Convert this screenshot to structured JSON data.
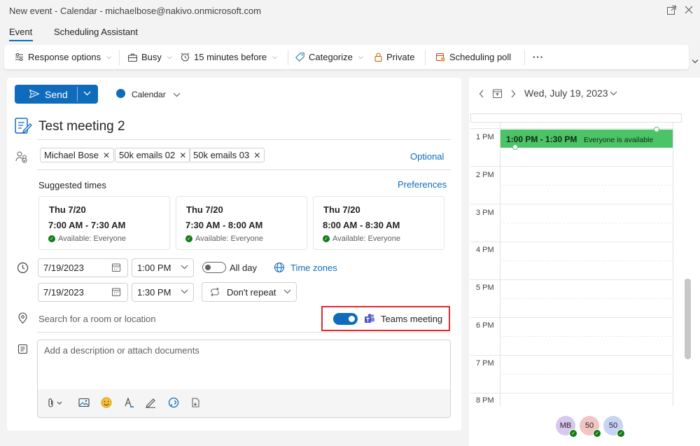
{
  "window": {
    "title": "New event - Calendar - michaelbose@nakivo.onmicrosoft.com"
  },
  "tabs": [
    {
      "label": "Event"
    },
    {
      "label": "Scheduling Assistant"
    }
  ],
  "ribbon": {
    "response_options": "Response options",
    "busy": "Busy",
    "reminder": "15 minutes before",
    "categorize": "Categorize",
    "private": "Private",
    "scheduling_poll": "Scheduling poll",
    "more": "···"
  },
  "compose": {
    "send_label": "Send",
    "calendar_label": "Calendar",
    "subject": "Test meeting 2",
    "attendees": [
      "Michael Bose",
      "50k emails 02",
      "50k emails 03"
    ],
    "optional_link": "Optional",
    "suggested_label": "Suggested times",
    "preferences_link": "Preferences",
    "suggestions": [
      {
        "day": "Thu 7/20",
        "time": "7:00 AM - 7:30 AM",
        "availability": "Available: Everyone"
      },
      {
        "day": "Thu 7/20",
        "time": "7:30 AM - 8:00 AM",
        "availability": "Available: Everyone"
      },
      {
        "day": "Thu 7/20",
        "time": "8:00 AM - 8:30 AM",
        "availability": "Available: Everyone"
      }
    ],
    "start_date": "7/19/2023",
    "start_time": "1:00 PM",
    "end_date": "7/19/2023",
    "end_time": "1:30 PM",
    "all_day_label": "All day",
    "time_zones_link": "Time zones",
    "repeat": "Don't repeat",
    "location_placeholder": "Search for a room or location",
    "teams_label": "Teams meeting",
    "description_placeholder": "Add a description or attach documents"
  },
  "calendar": {
    "date": "Wed, July 19, 2023",
    "hours": [
      "1 PM",
      "2 PM",
      "3 PM",
      "4 PM",
      "5 PM",
      "6 PM",
      "7 PM",
      "8 PM"
    ],
    "event": {
      "time": "1:00 PM - 1:30 PM",
      "availability": "Everyone is available"
    },
    "avatars": [
      {
        "initials": "MB",
        "color": "#d8c8ef"
      },
      {
        "initials": "50",
        "color": "#f2c4c4"
      },
      {
        "initials": "50",
        "color": "#c9d3f5"
      }
    ]
  },
  "colors": {
    "accent": "#0f6cbd",
    "event_green": "#4bc366",
    "highlight_red": "#e3282f"
  }
}
